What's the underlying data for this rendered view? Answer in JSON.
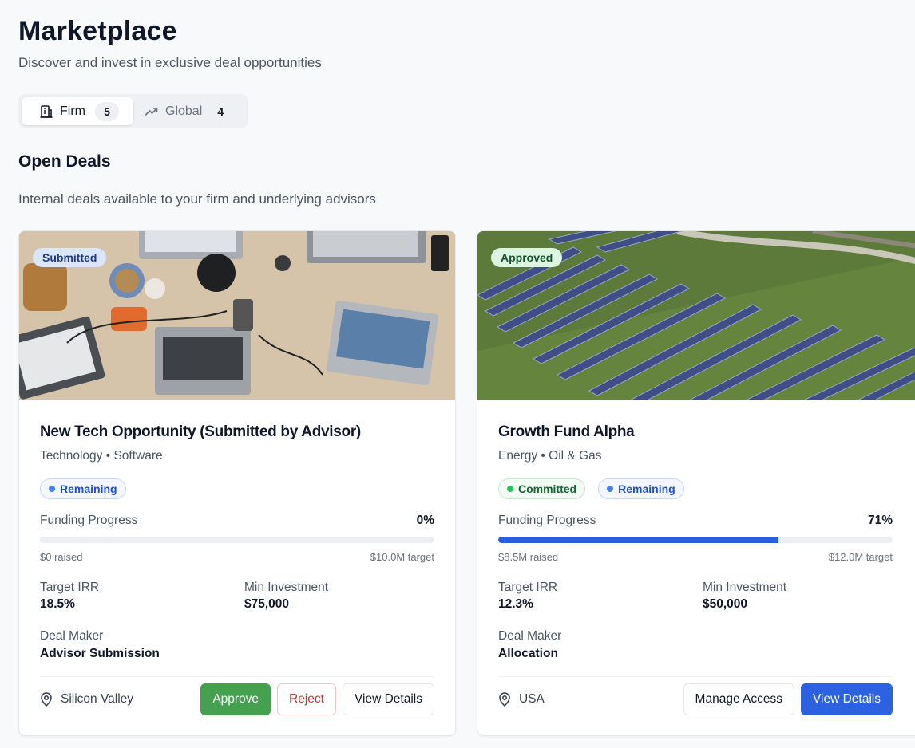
{
  "header": {
    "title": "Marketplace",
    "subtitle": "Discover and invest in exclusive deal opportunities"
  },
  "tabs": [
    {
      "label": "Firm",
      "count": "5",
      "icon": "building-icon",
      "active": true
    },
    {
      "label": "Global",
      "count": "4",
      "icon": "trending-up-icon",
      "active": false
    }
  ],
  "section": {
    "title": "Open Deals",
    "description": "Internal deals available to your firm and underlying advisors"
  },
  "deals": [
    {
      "status": "Submitted",
      "image": "laptops-on-desk-photo",
      "title": "New Tech Opportunity (Submitted by Advisor)",
      "subtitle": "Technology • Software",
      "tags": [
        "Remaining"
      ],
      "funding_label": "Funding Progress",
      "funding_pct": "0%",
      "progress": 0,
      "raised": "$0 raised",
      "target": "$10.0M target",
      "irr_label": "Target IRR",
      "irr_value": "18.5%",
      "min_label": "Min Investment",
      "min_value": "$75,000",
      "maker_label": "Deal Maker",
      "maker_value": "Advisor Submission",
      "location": "Silicon Valley",
      "buttons": {
        "approve": "Approve",
        "reject": "Reject",
        "details": "View Details"
      }
    },
    {
      "status": "Approved",
      "image": "solar-farm-aerial-photo",
      "title": "Growth Fund Alpha",
      "subtitle": "Energy • Oil & Gas",
      "tags": [
        "Committed",
        "Remaining"
      ],
      "funding_label": "Funding Progress",
      "funding_pct": "71%",
      "progress": 0.71,
      "raised": "$8.5M raised",
      "target": "$12.0M target",
      "irr_label": "Target IRR",
      "irr_value": "12.3%",
      "min_label": "Min Investment",
      "min_value": "$50,000",
      "maker_label": "Deal Maker",
      "maker_value": "Allocation",
      "location": "USA",
      "buttons": {
        "manage": "Manage Access",
        "details": "View Details"
      }
    }
  ],
  "colors": {
    "primary": "#2c62e0",
    "approve": "#45a04f",
    "reject": "#c53030"
  }
}
